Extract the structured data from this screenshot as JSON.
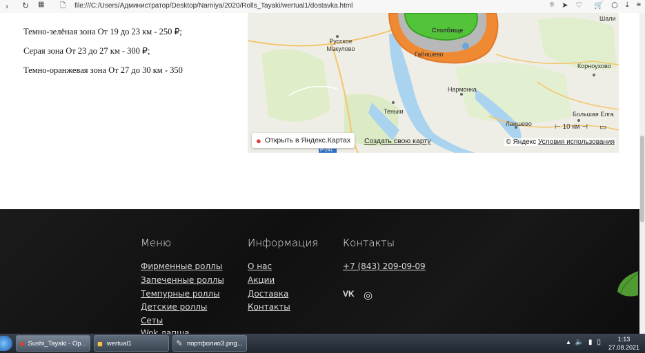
{
  "browser": {
    "url": "file:///C:/Users/Администратор/Desktop/Narniya/2020/Rolls_Tayaki/wertual1/dostavka.html"
  },
  "zones": [
    "Темно-зелёная зона От 19 до 23 км - 250 ₽;",
    "Серая зона От 23 до 27 км - 300 ₽;",
    "Темно-оранжевая зона От 27 до 30 км - 350"
  ],
  "map": {
    "places": [
      "Столбище",
      "Габишево",
      "Русское Макулово",
      "Нармонка",
      "Теньки",
      "Лаишево",
      "Большая Елга",
      "Корноухово",
      "Шали"
    ],
    "scale": "10 км",
    "road": "Р-241",
    "open_button": "Открыть в Яндекс.Картах",
    "create_link": "Создать свою карту",
    "copyright": "© Яндекс",
    "terms_link": "Условия использования"
  },
  "footer": {
    "menu_title": "Меню",
    "menu_items": [
      "Фирменные роллы",
      "Запеченные роллы",
      "Темпурные роллы",
      "Детские роллы",
      "Сеты",
      "Wok лапша"
    ],
    "info_title": "Информация",
    "info_items": [
      "О нас",
      "Акции",
      "Доставка",
      "Контакты"
    ],
    "contacts_title": "Контакты",
    "phone": "+7 (843) 209-09-09"
  },
  "taskbar": {
    "tasks": [
      "Sushi_Tayaki - Op...",
      "wertual1",
      "портфолио3.png..."
    ],
    "time": "1:13",
    "date": "27.08.2021"
  }
}
